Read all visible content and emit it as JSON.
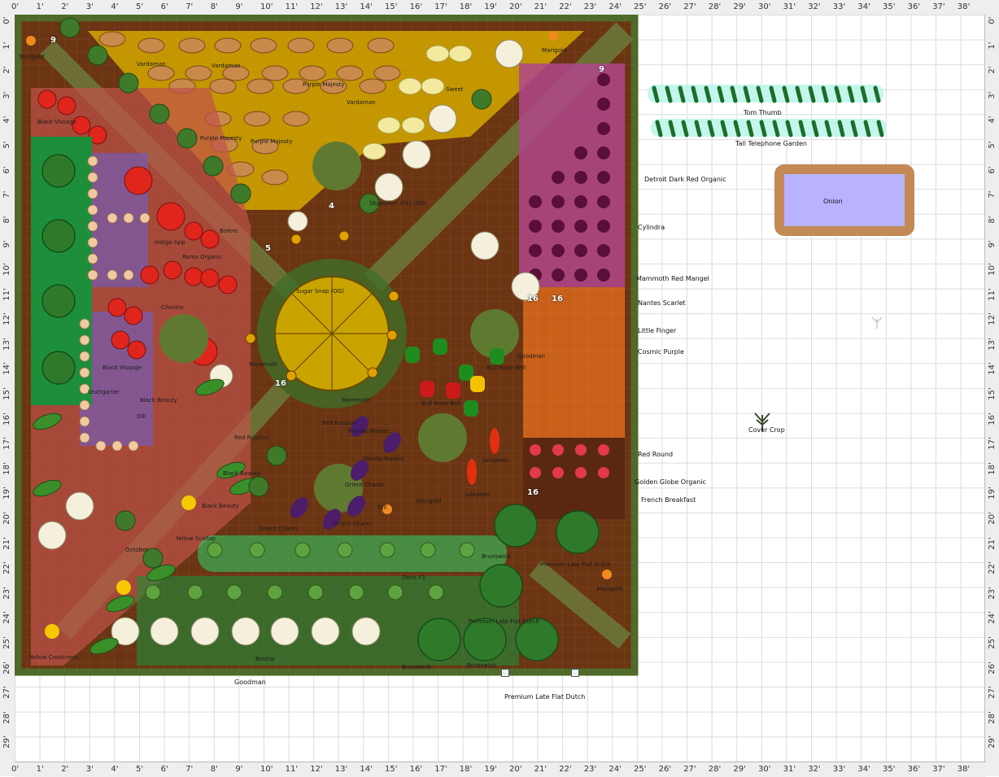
{
  "ruler": {
    "top": [
      "0'",
      "1'",
      "2'",
      "3'",
      "4'",
      "5'",
      "6'",
      "7'",
      "8'",
      "9'",
      "10'",
      "11'",
      "12'",
      "13'",
      "14'",
      "15'",
      "16'",
      "17'",
      "18'",
      "19'",
      "20'",
      "21'",
      "22'",
      "23'",
      "24'",
      "25'",
      "26'",
      "27'",
      "28'",
      "29'",
      "30'",
      "31'",
      "32'",
      "33'",
      "34'",
      "35'",
      "36'",
      "37'",
      "38'"
    ],
    "side": [
      "0'",
      "1'",
      "2'",
      "3'",
      "4'",
      "5'",
      "6'",
      "7'",
      "8'",
      "9'",
      "10'",
      "11'",
      "12'",
      "13'",
      "14'",
      "15'",
      "16'",
      "17'",
      "18'",
      "19'",
      "20'",
      "21'",
      "22'",
      "23'",
      "24'",
      "25'",
      "26'",
      "27'",
      "28'",
      "29'"
    ]
  },
  "colors": {
    "soil": "#6b3412",
    "bed_border": "#4f6a2a",
    "grass": "#1d8f3a",
    "potato_zone": "#d4a800",
    "beet_zone": "#b0468c",
    "carrot_zone": "#c8601a",
    "radish_zone": "#5a2810",
    "tomato_zone": "#c0524a",
    "onion_rect": "#b9b3ff",
    "trellis": "#c9a400"
  },
  "icons": [
    "cucumber-icon",
    "onion-icon",
    "cover-crop-icon",
    "tomato-icon",
    "cabbage-icon",
    "potato-icon",
    "beet-icon",
    "carrot-icon",
    "cauliflower-icon",
    "broccoli-icon",
    "pepper-icon",
    "eggplant-icon",
    "squash-icon",
    "sunflower-icon"
  ],
  "outside_labels": {
    "tom_thumb": "Tom Thumb",
    "tall_telephone": "Tall Telephone Garden",
    "detroit": "Detroit Dark Red Organic",
    "onion": "Onion",
    "cylindra": "Cylindra",
    "mammoth": "Mammoth Red Mangel",
    "nantes": "Nantes Scarlet",
    "little_finger": "Little Finger",
    "cosmic": "Cosmic Purple",
    "cover_crop": "Cover Crop",
    "red_round": "Red Round",
    "golden_globe": "Golden Globe Organic",
    "french_breakfast": "French Breakfast",
    "goodman": "Goodman",
    "premium_late": "Premium Late Flat Dutch"
  },
  "plot_labels": {
    "marigold_tl": "Marigold",
    "marigold_tr": "Marigold",
    "marigold_br": "Marigold",
    "marigold_mid": "Marigold",
    "vardaman": "Vardaman",
    "purple_majesty": "Purple Majesty",
    "black_vissage": "Black Vissage",
    "stuttgarter": "Stuttgarter",
    "indigo_apple": "Indigo App",
    "roma": "Roma Organic",
    "skywalker": "Skywalker (F1) (OG)",
    "sugar_snap": "Sugar Snap (OG)",
    "super_sweet": "Sweet",
    "bull_nose": "Bull Nose Bell",
    "jalapeno": "Jalapeno",
    "florida_market": "Florida Market",
    "orient_charm": "Orient Charm",
    "red_russian": "Red Russian",
    "black_beauty": "Black Beauty",
    "yellow_scallop": "Yellow Scallop",
    "yellow_crookneck": "Yellow Crookneck",
    "october": "October",
    "doric": "Doric F1",
    "brunswick": "Brunswick",
    "premium_in": "Premium Late Flat Dutch",
    "goodman_in": "Goodman",
    "belstar": "Belstar",
    "bolero": "Bolero",
    "cilantro": "Cilantro",
    "dill": "Dill",
    "mammoth_in": "Mammoth"
  },
  "counts": {
    "nine": "9",
    "sixteen": "16",
    "four": "4",
    "five": "5"
  }
}
